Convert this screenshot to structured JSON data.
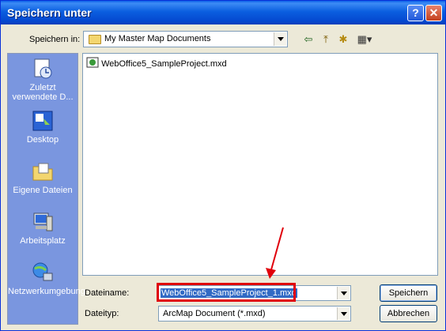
{
  "window": {
    "title": "Speichern unter"
  },
  "toolbar": {
    "save_in_label": "Speichern in:",
    "location_value": "My Master Map Documents"
  },
  "places": [
    {
      "label": "Zuletzt verwendete D..."
    },
    {
      "label": "Desktop"
    },
    {
      "label": "Eigene Dateien"
    },
    {
      "label": "Arbeitsplatz"
    },
    {
      "label": "Netzwerkumgebung"
    }
  ],
  "files": [
    {
      "name": "WebOffice5_SampleProject.mxd"
    }
  ],
  "form": {
    "filename_label": "Dateiname:",
    "filename_value": "WebOffice5_SampleProject_1.mxd",
    "filetype_label": "Dateityp:",
    "filetype_value": "ArcMap Document (*.mxd)"
  },
  "buttons": {
    "save": "Speichern",
    "cancel": "Abbrechen"
  },
  "colors": {
    "titlebar": "#0b5fe0",
    "places_bar": "#7a96df",
    "annotation": "#e0000b"
  }
}
